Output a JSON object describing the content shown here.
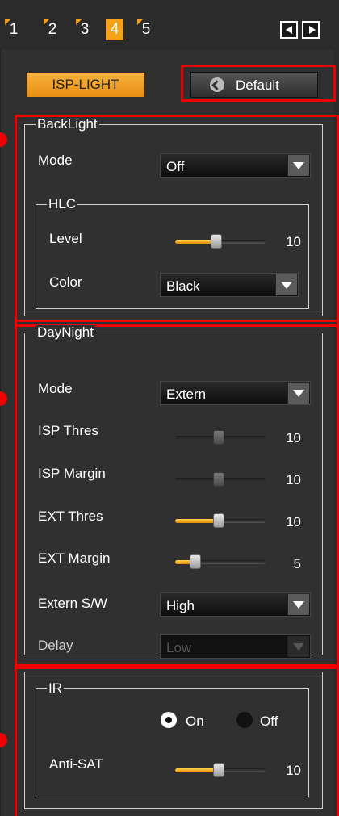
{
  "tabs": [
    {
      "label": "1",
      "active": false
    },
    {
      "label": "2",
      "active": false
    },
    {
      "label": "3",
      "active": false
    },
    {
      "label": "4",
      "active": true
    },
    {
      "label": "5",
      "active": false
    }
  ],
  "toolbar": {
    "isp_light_label": "ISP-LIGHT",
    "default_label": "Default"
  },
  "backlight": {
    "title": "BackLight",
    "mode_label": "Mode",
    "mode_value": "Off",
    "hlc": {
      "title": "HLC",
      "level_label": "Level",
      "level_value": "10",
      "color_label": "Color",
      "color_value": "Black"
    }
  },
  "daynight": {
    "title": "DayNight",
    "mode_label": "Mode",
    "mode_value": "Extern",
    "isp_thres_label": "ISP Thres",
    "isp_thres_value": "10",
    "isp_margin_label": "ISP Margin",
    "isp_margin_value": "10",
    "ext_thres_label": "EXT Thres",
    "ext_thres_value": "10",
    "ext_margin_label": "EXT Margin",
    "ext_margin_value": "5",
    "extern_sw_label": "Extern S/W",
    "extern_sw_value": "High",
    "delay_label": "Delay",
    "delay_value": "Low"
  },
  "ir": {
    "title": "IR",
    "on_label": "On",
    "off_label": "Off",
    "selected": "On",
    "anti_sat_label": "Anti-SAT",
    "anti_sat_value": "10"
  },
  "colors": {
    "accent": "#f3a21a",
    "highlight": "#e00000"
  }
}
